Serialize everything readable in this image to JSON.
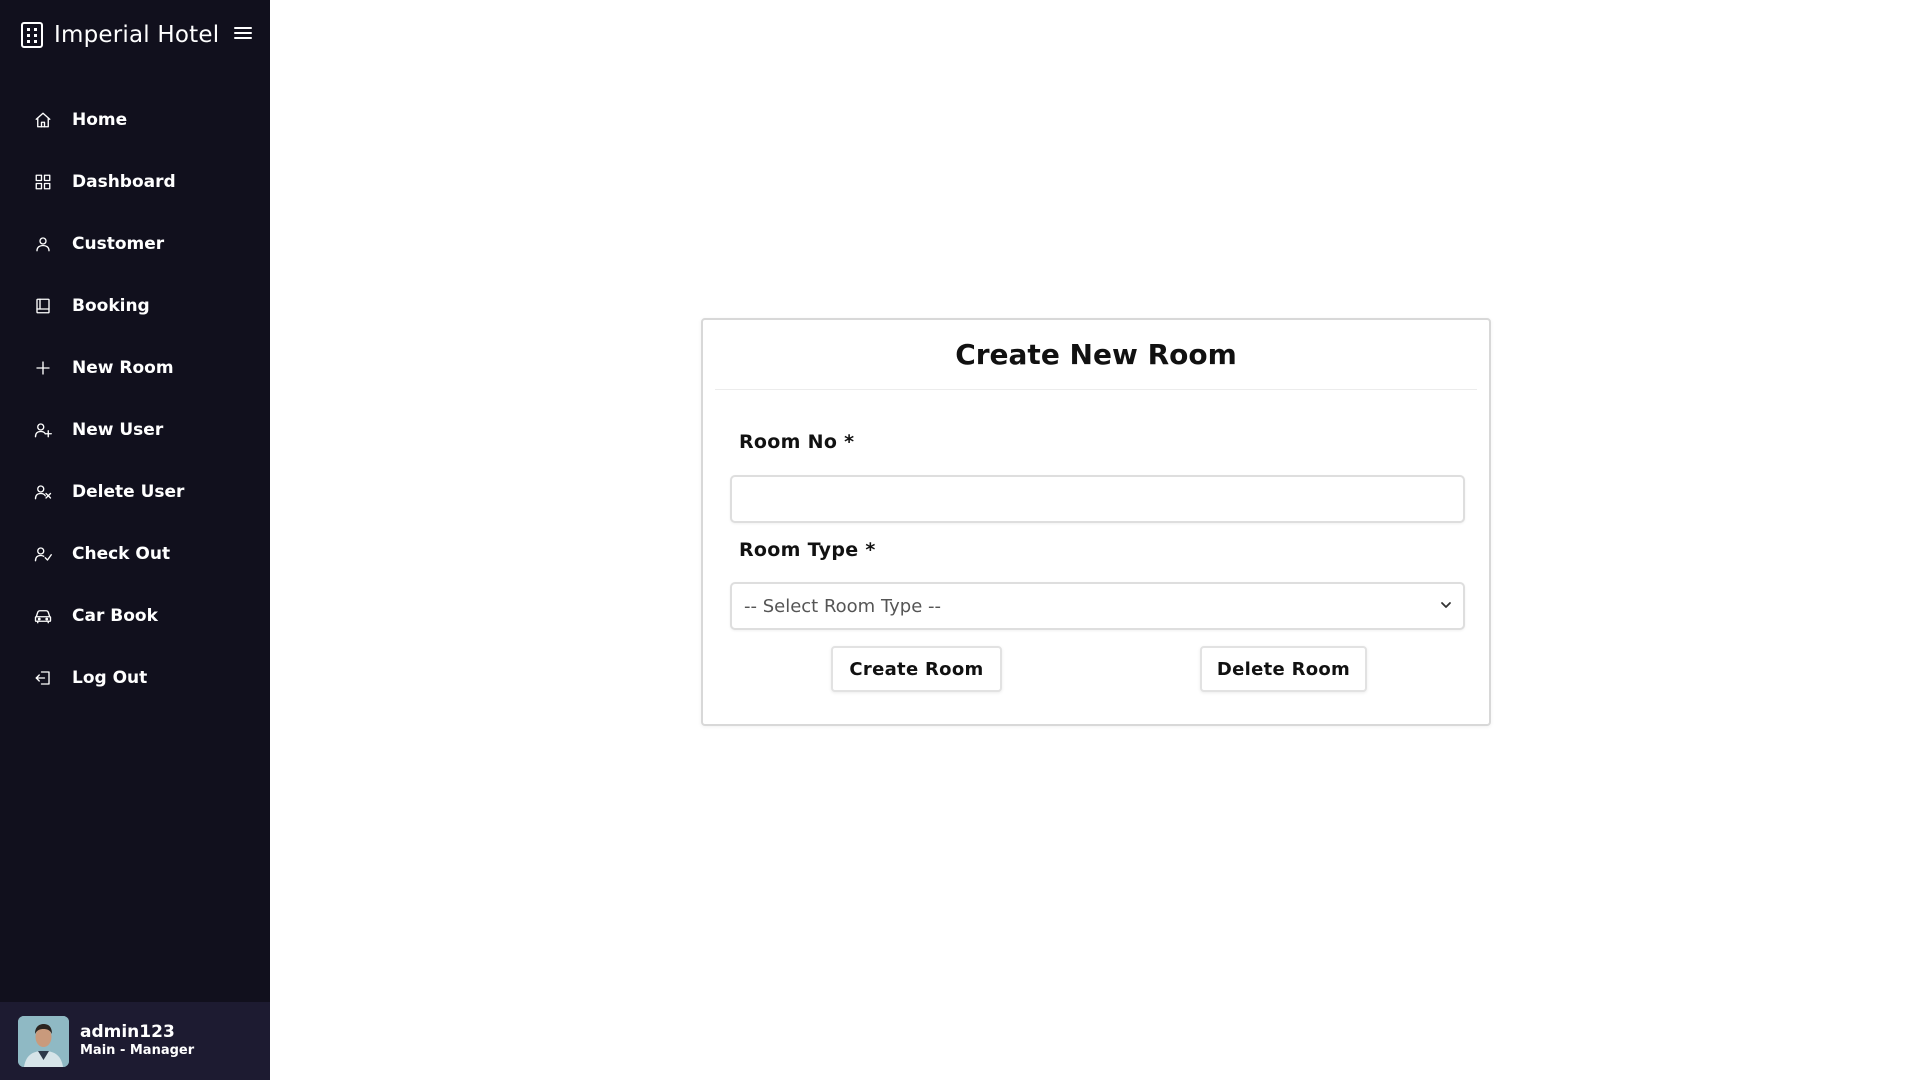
{
  "app": {
    "title": "Imperial Hotel"
  },
  "sidebar": {
    "items": [
      {
        "label": "Home",
        "icon": "home-icon"
      },
      {
        "label": "Dashboard",
        "icon": "grid-icon"
      },
      {
        "label": "Customer",
        "icon": "user-icon"
      },
      {
        "label": "Booking",
        "icon": "book-icon"
      },
      {
        "label": "New Room",
        "icon": "plus-icon"
      },
      {
        "label": "New User",
        "icon": "user-plus-icon"
      },
      {
        "label": "Delete User",
        "icon": "user-x-icon"
      },
      {
        "label": "Check Out",
        "icon": "user-check-icon"
      },
      {
        "label": "Car Book",
        "icon": "car-icon"
      },
      {
        "label": "Log Out",
        "icon": "logout-icon"
      }
    ],
    "profile": {
      "name": "admin123",
      "role": "Main - Manager"
    }
  },
  "form": {
    "title": "Create New Room",
    "room_no_label": "Room No *",
    "room_no_value": "",
    "room_type_label": "Room Type *",
    "room_type_selected": "-- Select Room Type --",
    "create_label": "Create Room",
    "delete_label": "Delete Room"
  },
  "colors": {
    "sidebar_bg": "#11101d",
    "profile_bg": "#1d1b31",
    "text": "#111111"
  }
}
